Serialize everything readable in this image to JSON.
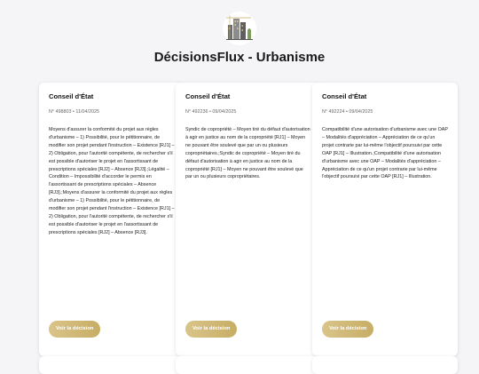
{
  "app": {
    "title": "DécisionsFlux - Urbanisme"
  },
  "colors": {
    "page_background": "#f5f5f7",
    "card_background": "#ffffff",
    "button_gold": "#c7ad64"
  },
  "icons": {
    "logo": "city-buildings-logo"
  },
  "cards": [
    {
      "court": "Conseil d'État",
      "meta": "N° 498803 • 11/04/2025",
      "summary": "Moyens d'assurer la conformité du projet aux règles d'urbanisme – 1) Possibilité, pour le pétitionnaire, de modifier son projet pendant l'instruction – Existence [RJ1] – 2) Obligation, pour l'autorité compétente, de rechercher s'il est possible d'autoriser le projet en l'assortissant de prescriptions spéciales [RJ2] – Absence [RJ3].;Légalité – Condition – Impossibilité d'accorder le permis en l'assortissant de prescriptions spéciales – Absence [RJ3].;Moyens d'assurer la conformité du projet aux règles d'urbanisme – 1) Possibilité, pour le pétitionnaire, de modifier son projet pendant l'instruction – Existence [RJ1] – 2) Obligation, pour l'autorité compétente, de rechercher s'il est possible d'autoriser le projet en l'assortissant de prescriptions spéciales [RJ2] – Absence [RJ3].",
      "button": "Voir la décision"
    },
    {
      "court": "Conseil d'État",
      "meta": "N° 492236 • 09/04/2025",
      "summary": "Syndic de copropriété – Moyen tiré du défaut d'autorisation à agir en justice au nom de la copropriété [RJ1] – Moyen ne pouvant être soulevé que par un ou plusieurs copropriétaires.;Syndic de copropriété – Moyen tiré du défaut d'autorisation à agir en justice au nom de la copropriété [RJ1] – Moyen ne pouvant être soulevé que par un ou plusieurs copropriétaires.",
      "button": "Voir la décision"
    },
    {
      "court": "Conseil d'État",
      "meta": "N° 492224 • 09/04/2025",
      "summary": "Compatibilité d'une autorisation d'urbanisme avec une OAP – Modalités d'appréciation – Appréciation de ce qu'un projet contrarie par lui-même l'objectif poursuivi par cette OAP [RJ1] – Illustration.;Compatibilité d'une autorisation d'urbanisme avec une OAP – Modalités d'appréciation – Appréciation de ce qu'un projet contrarie par lui-même l'objectif poursuivi par cette OAP [RJ1] – Illustration.",
      "button": "Voir la décision"
    }
  ]
}
